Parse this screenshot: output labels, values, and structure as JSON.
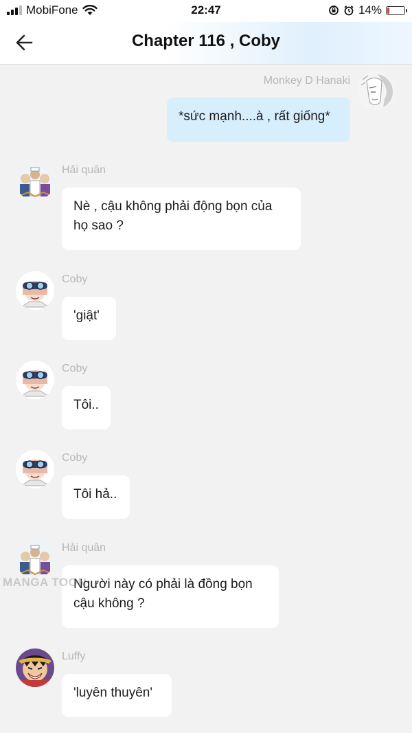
{
  "status_bar": {
    "carrier": "MobiFone",
    "time": "22:47",
    "battery_percent": "14%",
    "battery_level": 0.14,
    "icons": [
      "signal-icon",
      "wifi-icon",
      "orientation-lock-icon",
      "alarm-icon",
      "battery-icon"
    ]
  },
  "header": {
    "title": "Chapter 116 , Coby",
    "back_icon": "back-arrow-icon"
  },
  "watermark": "MANGA TOON",
  "messages": [
    {
      "sender": "Monkey D Hanaki",
      "text": "*sức mạnh....à , rất giống*",
      "side": "right"
    },
    {
      "sender": "Hải quân",
      "text_lines": [
        "Nè , cậu không phải động bọn của",
        "họ sao ?"
      ],
      "side": "left"
    },
    {
      "sender": "Coby",
      "text": "'giật'",
      "side": "left"
    },
    {
      "sender": "Coby",
      "text": "Tôi..",
      "side": "left"
    },
    {
      "sender": "Coby",
      "text": "Tôi hả..",
      "side": "left"
    },
    {
      "sender": "Hải quân",
      "text_lines": [
        "Người này có phải là đồng bọn",
        "cậu không ?"
      ],
      "side": "left"
    },
    {
      "sender": "Luffy",
      "text": "'luyên thuyên'",
      "side": "left"
    }
  ],
  "colors": {
    "background": "#f2f2f2",
    "own_bubble": "#d7eefc",
    "other_bubble": "#ffffff",
    "sender_name": "#b7b7b7"
  }
}
